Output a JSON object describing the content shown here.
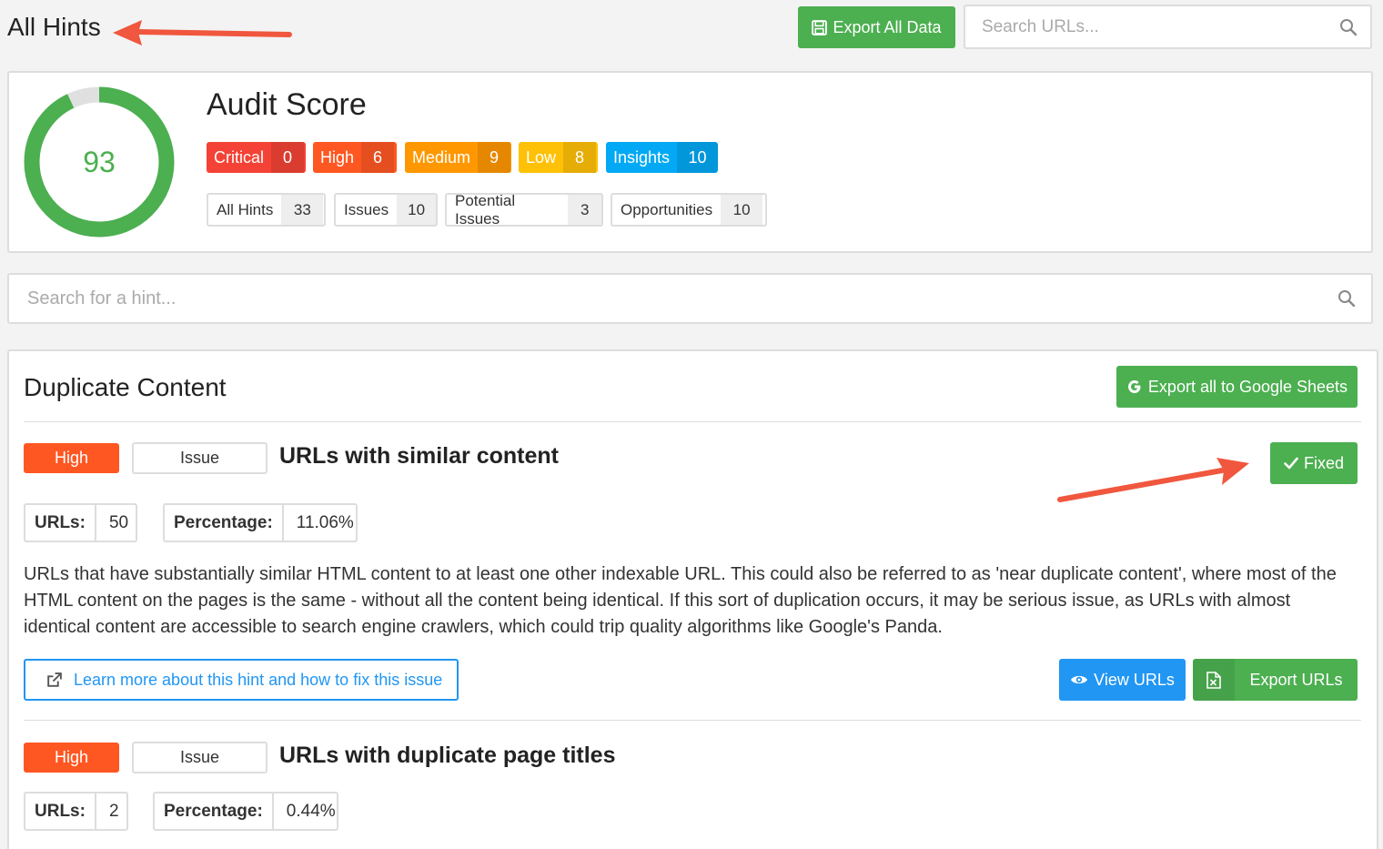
{
  "header": {
    "title": "All Hints",
    "export_label": "Export All Data",
    "search_placeholder": "Search URLs..."
  },
  "score": {
    "title": "Audit Score",
    "value": "93",
    "fraction": 0.93,
    "color": "#4caf50",
    "track_color": "#e0e0e0"
  },
  "severity": [
    {
      "label": "Critical",
      "count": "0",
      "color": "#f44336"
    },
    {
      "label": "High",
      "count": "6",
      "color": "#ff5722"
    },
    {
      "label": "Medium",
      "count": "9",
      "color": "#ff9800"
    },
    {
      "label": "Low",
      "count": "8",
      "color": "#ffc107"
    },
    {
      "label": "Insights",
      "count": "10",
      "color": "#03a9f4"
    }
  ],
  "counts": [
    {
      "label": "All Hints",
      "count": "33"
    },
    {
      "label": "Issues",
      "count": "10"
    },
    {
      "label": "Potential Issues",
      "count": "3"
    },
    {
      "label": "Opportunities",
      "count": "10"
    }
  ],
  "hint_search": {
    "placeholder": "Search for a hint..."
  },
  "section": {
    "title": "Duplicate Content",
    "export_sheets_label": "Export all to Google Sheets"
  },
  "hints": [
    {
      "priority": "High",
      "type": "Issue",
      "title": "URLs with similar content",
      "urls_label": "URLs:",
      "urls": "50",
      "pct_label": "Percentage:",
      "pct": "11.06%",
      "fixed_label": "Fixed",
      "description": "URLs that have substantially similar HTML content to at least one other indexable URL. This could also be referred to as 'near duplicate content', where most of the HTML content on the pages is the same - without all the content being identical. If this sort of duplication occurs, it may be serious issue, as URLs with almost identical content are accessible to search engine crawlers, which could trip quality algorithms like Google's Panda.",
      "learn_label": "Learn more about this hint and how to fix this issue",
      "view_label": "View URLs",
      "export_label": "Export URLs"
    },
    {
      "priority": "High",
      "type": "Issue",
      "title": "URLs with duplicate page titles",
      "urls_label": "URLs:",
      "urls": "2",
      "pct_label": "Percentage:",
      "pct": "0.44%"
    }
  ]
}
